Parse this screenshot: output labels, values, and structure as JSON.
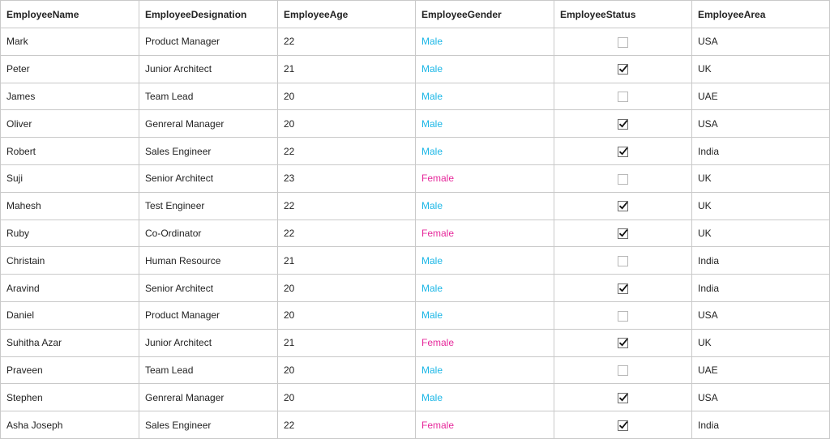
{
  "columns": [
    "EmployeeName",
    "EmployeeDesignation",
    "EmployeeAge",
    "EmployeeGender",
    "EmployeeStatus",
    "EmployeeArea"
  ],
  "colors": {
    "male": "#1ab6e6",
    "female": "#e6299b",
    "grid_line": "#c9c9c9"
  },
  "rows": [
    {
      "name": "Mark",
      "designation": "Product Manager",
      "age": "22",
      "gender": "Male",
      "status": false,
      "area": "USA"
    },
    {
      "name": "Peter",
      "designation": "Junior Architect",
      "age": "21",
      "gender": "Male",
      "status": true,
      "area": "UK"
    },
    {
      "name": "James",
      "designation": "Team Lead",
      "age": "20",
      "gender": "Male",
      "status": false,
      "area": "UAE"
    },
    {
      "name": "Oliver",
      "designation": "Genreral Manager",
      "age": "20",
      "gender": "Male",
      "status": true,
      "area": "USA"
    },
    {
      "name": "Robert",
      "designation": "Sales Engineer",
      "age": "22",
      "gender": "Male",
      "status": true,
      "area": "India"
    },
    {
      "name": "Suji",
      "designation": "Senior Architect",
      "age": "23",
      "gender": "Female",
      "status": false,
      "area": "UK"
    },
    {
      "name": "Mahesh",
      "designation": "Test Engineer",
      "age": "22",
      "gender": "Male",
      "status": true,
      "area": "UK"
    },
    {
      "name": "Ruby",
      "designation": "Co-Ordinator",
      "age": "22",
      "gender": "Female",
      "status": true,
      "area": "UK"
    },
    {
      "name": "Christain",
      "designation": "Human Resource",
      "age": "21",
      "gender": "Male",
      "status": false,
      "area": "India"
    },
    {
      "name": "Aravind",
      "designation": "Senior Architect",
      "age": "20",
      "gender": "Male",
      "status": true,
      "area": "India"
    },
    {
      "name": "Daniel",
      "designation": "Product Manager",
      "age": "20",
      "gender": "Male",
      "status": false,
      "area": "USA"
    },
    {
      "name": "Suhitha Azar",
      "designation": "Junior Architect",
      "age": "21",
      "gender": "Female",
      "status": true,
      "area": "UK"
    },
    {
      "name": "Praveen",
      "designation": "Team Lead",
      "age": "20",
      "gender": "Male",
      "status": false,
      "area": "UAE"
    },
    {
      "name": "Stephen",
      "designation": "Genreral Manager",
      "age": "20",
      "gender": "Male",
      "status": true,
      "area": "USA"
    },
    {
      "name": "Asha Joseph",
      "designation": "Sales Engineer",
      "age": "22",
      "gender": "Female",
      "status": true,
      "area": "India"
    }
  ]
}
